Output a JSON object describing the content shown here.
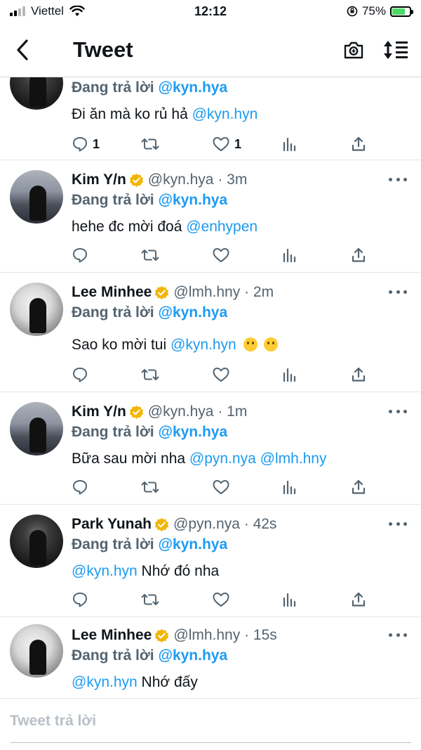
{
  "status_bar": {
    "carrier": "Viettel",
    "time": "12:12",
    "battery": "75%",
    "battery_fraction": 0.75
  },
  "nav": {
    "title": "Tweet"
  },
  "reply_prefix": "Đang trả lời",
  "tweets": [
    {
      "name": "",
      "handle": "",
      "time": "",
      "reply_to": "@kyn.hya",
      "body_plain": "Đi ăn mà ko rủ hả ",
      "body_mention": "@kyn.hyn",
      "reply_count": "1",
      "like_count": "1"
    },
    {
      "name": "Kim Y/n",
      "handle": "@kyn.hya",
      "time": "3m",
      "reply_to": "@kyn.hya",
      "body_plain": "hehe đc mời đoá ",
      "body_mention": "@enhypen"
    },
    {
      "name": "Lee Minhee",
      "handle": "@lmh.hny",
      "time": "2m",
      "reply_to": "@kyn.hya",
      "body_plain": "Sao ko mời tui ",
      "body_mention": "@kyn.hyn"
    },
    {
      "name": "Kim Y/n",
      "handle": "@kyn.hya",
      "time": "1m",
      "reply_to": "@kyn.hya",
      "body_plain": "Bữa sau mời nha ",
      "body_mention": "@pyn.nya",
      "body_mention_2": "@lmh.hny"
    },
    {
      "name": "Park Yunah",
      "handle": "@pyn.nya",
      "time": "42s",
      "reply_to": "@kyn.hya",
      "body_mention": "@kyn.hyn",
      "body_plain": " Nhớ đó nha"
    },
    {
      "name": "Lee Minhee",
      "handle": "@lmh.hny",
      "time": "15s",
      "reply_to": "@kyn.hya",
      "body_mention": "@kyn.hyn",
      "body_plain": " Nhớ đấy"
    }
  ],
  "reply_bar": {
    "placeholder": "Tweet trả lời"
  },
  "icons": {
    "back": "chevron-left-icon",
    "camera": "camera-icon",
    "sort": "sort-icon",
    "reply": "comment-icon",
    "retweet": "retweet-icon",
    "like": "heart-icon",
    "analytics": "analytics-icon",
    "share": "share-icon",
    "verified": "verified-badge-icon"
  },
  "colors": {
    "link": "#1d9bf0",
    "muted": "#536471",
    "verified": "#f4b400",
    "battery": "#4cd964"
  }
}
